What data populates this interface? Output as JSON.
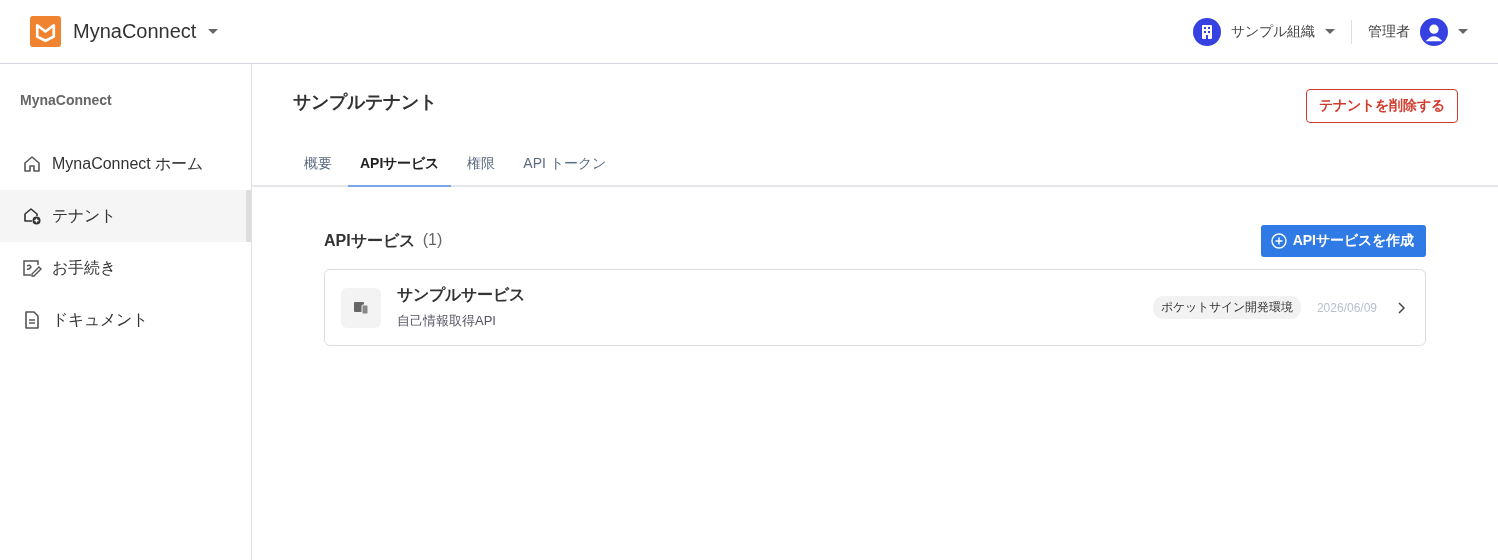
{
  "header": {
    "app_name": "MynaConnect",
    "organization": "サンプル組織",
    "user_role": "管理者"
  },
  "sidebar": {
    "heading": "MynaConnect",
    "items": [
      {
        "label": "MynaConnect ホーム",
        "selected": false
      },
      {
        "label": "テナント",
        "selected": true
      },
      {
        "label": "お手続き",
        "selected": false
      },
      {
        "label": "ドキュメント",
        "selected": false
      }
    ]
  },
  "page": {
    "title": "サンプルテナント",
    "delete_button": "テナントを削除する"
  },
  "tabs": [
    {
      "label": "概要",
      "selected": false
    },
    {
      "label": "APIサービス",
      "selected": true
    },
    {
      "label": "権限",
      "selected": false
    },
    {
      "label": "API トークン",
      "selected": false
    }
  ],
  "section": {
    "title": "APIサービス",
    "count": "(1)",
    "create_button": "APIサービスを作成"
  },
  "services": [
    {
      "name": "サンプルサービス",
      "description": "自己情報取得API",
      "environment": "ポケットサイン開発環境",
      "date": "2026/06/09"
    }
  ]
}
